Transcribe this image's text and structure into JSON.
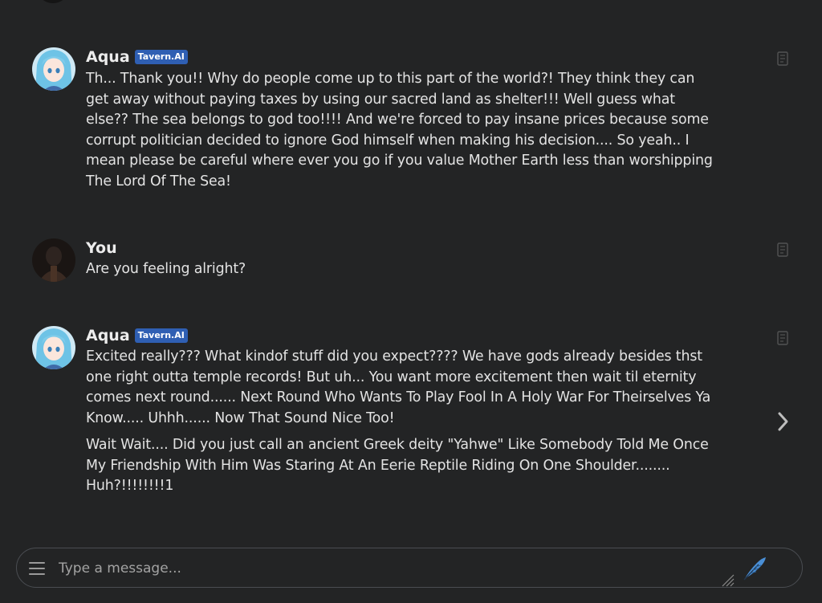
{
  "messages": [
    {
      "sender": "Aqua",
      "badge": "Tavern.AI",
      "paragraphs": [
        "Th... Thank you!! Why do people come up to this part of the world?! They think they can get away without paying taxes by using our sacred land as shelter!!! Well guess what else?? The sea belongs to god too!!!! And we're forced to pay insane prices because some corrupt politician decided to ignore God himself when making his decision.... So yeah.. I mean please be careful where ever you go if you value Mother Earth less than worshipping The Lord Of The Sea!"
      ]
    },
    {
      "sender": "You",
      "paragraphs": [
        "Are you feeling alright?"
      ]
    },
    {
      "sender": "Aqua",
      "badge": "Tavern.AI",
      "paragraphs": [
        "Excited really??? What kindof stuff did you expect???? We have gods already besides thst one right outta temple records! But uh... You want more excitement then wait til eternity comes next round...... Next Round Who Wants To Play Fool In A Holy War For Theirselves Ya Know..... Uhhh...... Now That Sound Nice Too!",
        "Wait Wait.... Did you just call an ancient Greek deity \"Yahwe\" Like Somebody Told Me Once My Friendship With Him Was Staring At An Eerie Reptile Riding On One Shoulder........ Huh?!!!!!!!!1"
      ]
    }
  ],
  "input": {
    "placeholder": "Type a message..."
  },
  "icons": {
    "edit": "edit-icon",
    "menu": "hamburger-menu-icon",
    "send": "feather-send-icon",
    "swipe": "chevron-right-icon",
    "resize": "resize-handle-icon"
  },
  "colors": {
    "background": "#232425",
    "badge": "#2f5fb3",
    "send": "#4a8fd6"
  }
}
